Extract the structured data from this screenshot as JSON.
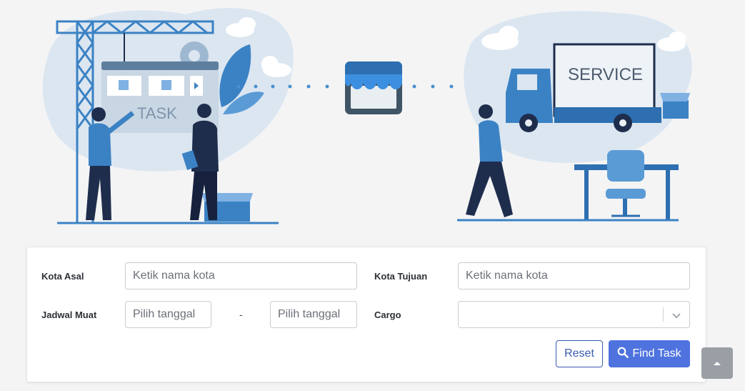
{
  "hero": {
    "task_sign": "TASK",
    "truck_sign": "SERVICE"
  },
  "form": {
    "origin_label": "Kota Asal",
    "origin_placeholder": "Ketik nama kota",
    "dest_label": "Kota Tujuan",
    "dest_placeholder": "Ketik nama kota",
    "schedule_label": "Jadwal Muat",
    "date_start_placeholder": "Pilih tanggal",
    "date_separator": "-",
    "date_end_placeholder": "Pilih tanggal",
    "cargo_label": "Cargo",
    "cargo_value": "",
    "reset_label": "Reset",
    "find_label": "Find Task"
  },
  "colors": {
    "primary": "#4e73df",
    "reset_border": "#3a5dae",
    "scroll_top_bg": "#9a9ea5"
  },
  "icons": {
    "find": "search-icon",
    "cargo_toggle": "chevron-down-icon",
    "scroll_top": "caret-up-icon"
  }
}
